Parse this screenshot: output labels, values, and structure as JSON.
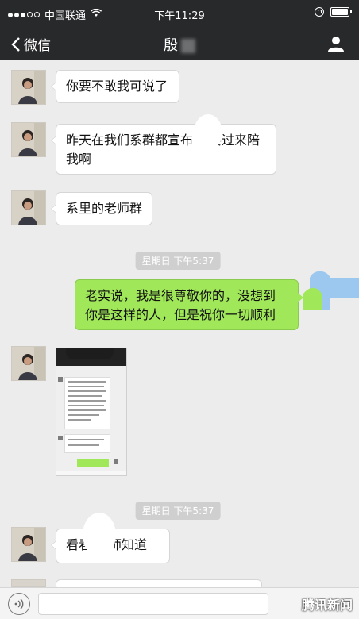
{
  "status_bar": {
    "carrier": "中国联通",
    "time": "下午11:29"
  },
  "nav_bar": {
    "back_label": "微信",
    "title": "殷"
  },
  "messages": [
    {
      "side": "left",
      "text": "你要不敢我可说了"
    },
    {
      "side": "left",
      "text": "昨天在我们系群都宣布你要过来陪我啊",
      "line1": "昨天在我们系群都宣布",
      "line1b": "要过来陪",
      "line2": "我啊"
    },
    {
      "side": "left",
      "text": "系里的老师群"
    },
    {
      "side": "time",
      "text": "星期日 下午5:37"
    },
    {
      "side": "right",
      "line1": "老实说，我是很尊敬你的，没想到",
      "line2": "你是这样的人，但是祝你一切顺利"
    },
    {
      "side": "left",
      "type": "image"
    },
    {
      "side": "time",
      "text": "星期日 下午5:37"
    },
    {
      "side": "left",
      "text_a": "看看",
      "text_b": "老师知道"
    }
  ],
  "input_bar": {
    "voice_icon": "voice-icon",
    "watermark": "腾讯新闻"
  },
  "colors": {
    "bar_bg": "#28292b",
    "chat_bg": "#ececec",
    "bubble_right": "#a0e75a"
  }
}
